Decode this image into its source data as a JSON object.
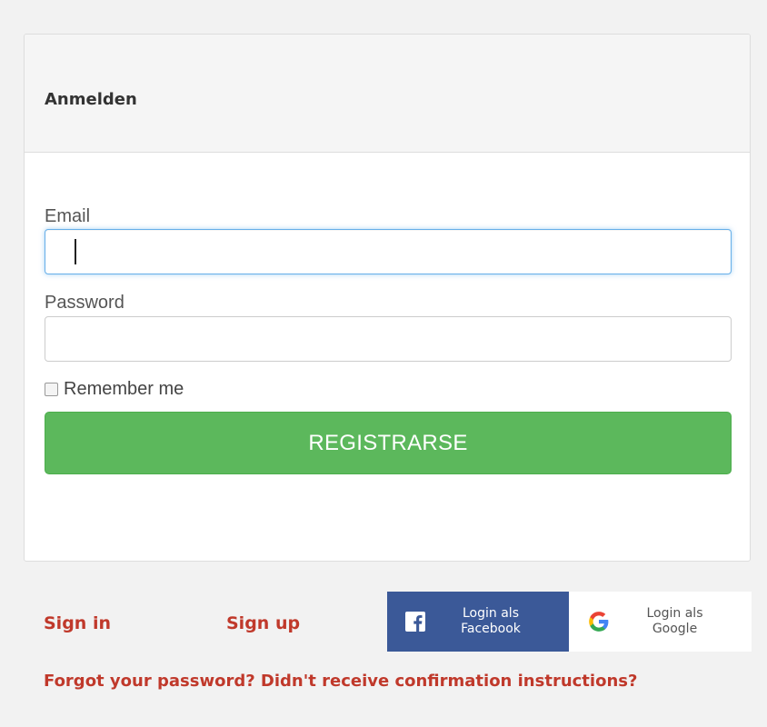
{
  "login_panel": {
    "heading": "Anmelden",
    "email_label": "Email",
    "email_value": "",
    "email_placeholder": "",
    "password_label": "Password",
    "password_value": "",
    "remember_label": "Remember me",
    "remember_checked": false,
    "submit_label": "REGISTRARSE"
  },
  "links": {
    "sign_in": "Sign in",
    "sign_up": "Sign up",
    "forgot": "Forgot your password? Didn't receive confirmation instructions?"
  },
  "social": {
    "facebook": {
      "icon": "facebook-icon",
      "line1": "Login als",
      "line2": "Facebook"
    },
    "google": {
      "icon": "google-icon",
      "line1": "Login als",
      "line2": "Google"
    }
  },
  "colors": {
    "submit": "#5cb85c",
    "link": "#c0392b",
    "facebook": "#3b5998",
    "focus_border": "#66afe9"
  }
}
